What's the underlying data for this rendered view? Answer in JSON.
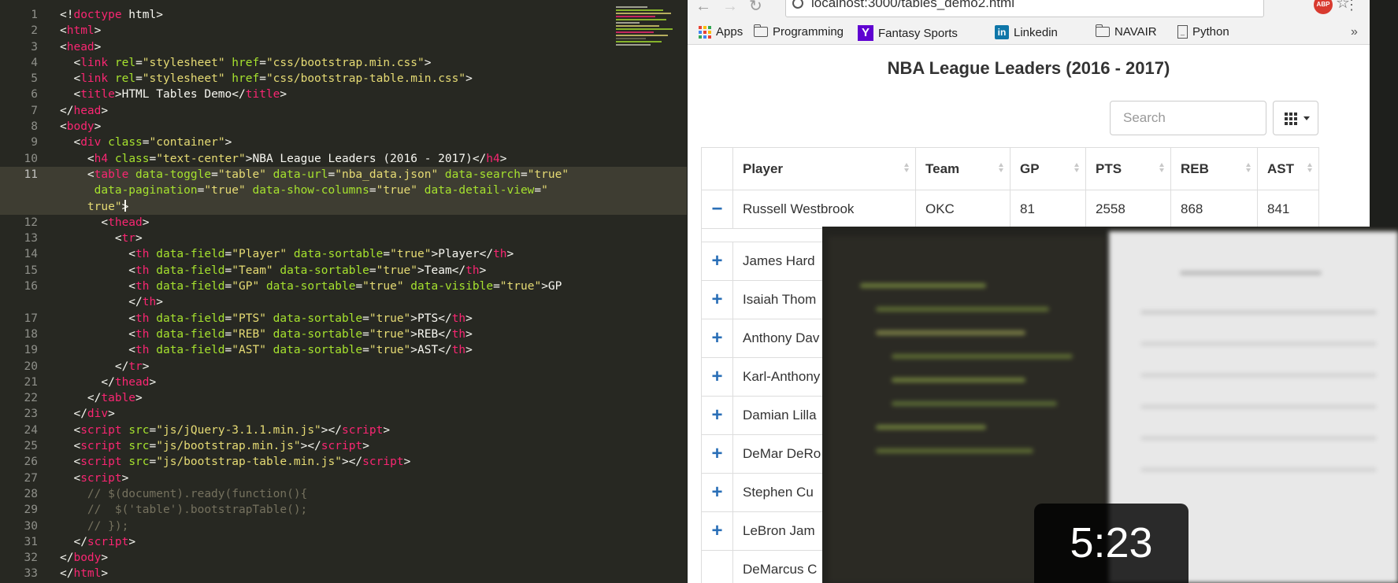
{
  "editor": {
    "lines": [
      {
        "n": "1",
        "html": "&lt;!<span class='tag'>doctype</span> html&gt;"
      },
      {
        "n": "2",
        "html": "&lt;<span class='tag'>html</span>&gt;"
      },
      {
        "n": "3",
        "html": "&lt;<span class='tag'>head</span>&gt;"
      },
      {
        "n": "4",
        "html": "  &lt;<span class='tag'>link</span> <span class='attr'>rel</span>=<span class='str'>\"stylesheet\"</span> <span class='attr'>href</span>=<span class='str'>\"css/bootstrap.min.css\"</span>&gt;"
      },
      {
        "n": "5",
        "html": "  &lt;<span class='tag'>link</span> <span class='attr'>rel</span>=<span class='str'>\"stylesheet\"</span> <span class='attr'>href</span>=<span class='str'>\"css/bootstrap-table.min.css\"</span>&gt;"
      },
      {
        "n": "6",
        "html": "  &lt;<span class='tag'>title</span>&gt;HTML Tables Demo&lt;/<span class='tag'>title</span>&gt;"
      },
      {
        "n": "7",
        "html": "&lt;/<span class='tag'>head</span>&gt;"
      },
      {
        "n": "8",
        "html": "&lt;<span class='tag'>body</span>&gt;"
      },
      {
        "n": "9",
        "html": "  &lt;<span class='tag'>div</span> <span class='attr'>class</span>=<span class='str'>\"container\"</span>&gt;"
      },
      {
        "n": "10",
        "html": "    &lt;<span class='tag'>h4</span> <span class='attr'>class</span>=<span class='str'>\"text-center\"</span>&gt;NBA League Leaders (2016 - 2017)&lt;/<span class='tag'>h4</span>&gt;"
      },
      {
        "n": "11",
        "html": "    &lt;<span class='tag'>table</span> <span class='attr'>data-toggle</span>=<span class='str'>\"table\"</span> <span class='attr'>data-url</span>=<span class='str'>\"nba_data.json\"</span> <span class='attr'>data-search</span>=<span class='str'>\"true\"</span>",
        "active": true
      },
      {
        "n": "",
        "html": "     <span class='attr'>data-pagination</span>=<span class='str'>\"true\"</span> <span class='attr'>data-show-columns</span>=<span class='str'>\"true\"</span> <span class='attr'>data-detail-view</span>=<span class='str'>\"</span>",
        "active": true
      },
      {
        "n": "",
        "html": "    <span class='str'>true\"</span>&gt;",
        "active": true
      },
      {
        "n": "12",
        "html": "      &lt;<span class='tag'>thead</span>&gt;"
      },
      {
        "n": "13",
        "html": "        &lt;<span class='tag'>tr</span>&gt;"
      },
      {
        "n": "14",
        "html": "          &lt;<span class='tag'>th</span> <span class='attr'>data-field</span>=<span class='str'>\"Player\"</span> <span class='attr'>data-sortable</span>=<span class='str'>\"true\"</span>&gt;Player&lt;/<span class='tag'>th</span>&gt;"
      },
      {
        "n": "15",
        "html": "          &lt;<span class='tag'>th</span> <span class='attr'>data-field</span>=<span class='str'>\"Team\"</span> <span class='attr'>data-sortable</span>=<span class='str'>\"true\"</span>&gt;Team&lt;/<span class='tag'>th</span>&gt;"
      },
      {
        "n": "16",
        "html": "          &lt;<span class='tag'>th</span> <span class='attr'>data-field</span>=<span class='str'>\"GP\"</span> <span class='attr'>data-sortable</span>=<span class='str'>\"true\"</span> <span class='attr'>data-visible</span>=<span class='str'>\"true\"</span>&gt;GP"
      },
      {
        "n": "",
        "html": "          &lt;/<span class='tag'>th</span>&gt;"
      },
      {
        "n": "17",
        "html": "          &lt;<span class='tag'>th</span> <span class='attr'>data-field</span>=<span class='str'>\"PTS\"</span> <span class='attr'>data-sortable</span>=<span class='str'>\"true\"</span>&gt;PTS&lt;/<span class='tag'>th</span>&gt;"
      },
      {
        "n": "18",
        "html": "          &lt;<span class='tag'>th</span> <span class='attr'>data-field</span>=<span class='str'>\"REB\"</span> <span class='attr'>data-sortable</span>=<span class='str'>\"true\"</span>&gt;REB&lt;/<span class='tag'>th</span>&gt;"
      },
      {
        "n": "19",
        "html": "          &lt;<span class='tag'>th</span> <span class='attr'>data-field</span>=<span class='str'>\"AST\"</span> <span class='attr'>data-sortable</span>=<span class='str'>\"true\"</span>&gt;AST&lt;/<span class='tag'>th</span>&gt;"
      },
      {
        "n": "20",
        "html": "        &lt;/<span class='tag'>tr</span>&gt;"
      },
      {
        "n": "21",
        "html": "      &lt;/<span class='tag'>thead</span>&gt;"
      },
      {
        "n": "22",
        "html": "    &lt;/<span class='tag'>table</span>&gt;"
      },
      {
        "n": "23",
        "html": "  &lt;/<span class='tag'>div</span>&gt;"
      },
      {
        "n": "24",
        "html": "  &lt;<span class='tag'>script</span> <span class='attr'>src</span>=<span class='str'>\"js/jQuery-3.1.1.min.js\"</span>&gt;&lt;/<span class='tag'>script</span>&gt;"
      },
      {
        "n": "25",
        "html": "  &lt;<span class='tag'>script</span> <span class='attr'>src</span>=<span class='str'>\"js/bootstrap.min.js\"</span>&gt;&lt;/<span class='tag'>script</span>&gt;"
      },
      {
        "n": "26",
        "html": "  &lt;<span class='tag'>script</span> <span class='attr'>src</span>=<span class='str'>\"js/bootstrap-table.min.js\"</span>&gt;&lt;/<span class='tag'>script</span>&gt;"
      },
      {
        "n": "27",
        "html": "  &lt;<span class='tag'>script</span>&gt;"
      },
      {
        "n": "28",
        "html": "    <span class='cmt'>// $(document).ready(function(){</span>"
      },
      {
        "n": "29",
        "html": "    <span class='cmt'>//  $('table').bootstrapTable();</span>"
      },
      {
        "n": "30",
        "html": "    <span class='cmt'>// });</span>"
      },
      {
        "n": "31",
        "html": "  &lt;/<span class='tag'>script</span>&gt;"
      },
      {
        "n": "32",
        "html": "&lt;/<span class='tag'>body</span>&gt;"
      },
      {
        "n": "33",
        "html": "&lt;/<span class='tag'>html</span>&gt;"
      }
    ],
    "colors": {
      "bg": "#272822",
      "tag": "#f92672",
      "attr": "#a6e22e",
      "string": "#e6db74",
      "comment": "#75715e"
    }
  },
  "browser": {
    "url": "localhost:3000/tables_demo2.html",
    "bookmarks": [
      {
        "label": "Apps",
        "icon": "apps-icon"
      },
      {
        "label": "Programming",
        "icon": "folder-icon"
      },
      {
        "label": "Fantasy Sports",
        "icon": "yahoo-icon"
      },
      {
        "label": "Linkedin",
        "icon": "linkedin-icon"
      },
      {
        "label": "NAVAIR",
        "icon": "folder-icon"
      },
      {
        "label": "Python",
        "icon": "document-icon"
      }
    ],
    "more_bookmarks": "»",
    "abp_badge": "ABP"
  },
  "page": {
    "title": "NBA League Leaders (2016 - 2017)",
    "search_placeholder": "Search",
    "columns": [
      "Player",
      "Team",
      "GP",
      "PTS",
      "REB",
      "AST"
    ],
    "expanded_row": {
      "toggle": "−",
      "Player": "Russell Westbrook",
      "Team": "OKC",
      "GP": "81",
      "PTS": "2558",
      "REB": "868",
      "AST": "841"
    },
    "rows": [
      {
        "toggle": "+",
        "player": "James Hard"
      },
      {
        "toggle": "+",
        "player": "Isaiah Thom"
      },
      {
        "toggle": "+",
        "player": "Anthony Dav"
      },
      {
        "toggle": "+",
        "player": "Karl-Anthony"
      },
      {
        "toggle": "+",
        "player": "Damian Lilla"
      },
      {
        "toggle": "+",
        "player": "DeMar DeRo"
      },
      {
        "toggle": "+",
        "player": "Stephen Cu"
      },
      {
        "toggle": "+",
        "player": "LeBron Jam"
      },
      {
        "toggle": "",
        "player": "DeMarcus C"
      }
    ]
  },
  "overlay": {
    "duration": "5:23"
  }
}
